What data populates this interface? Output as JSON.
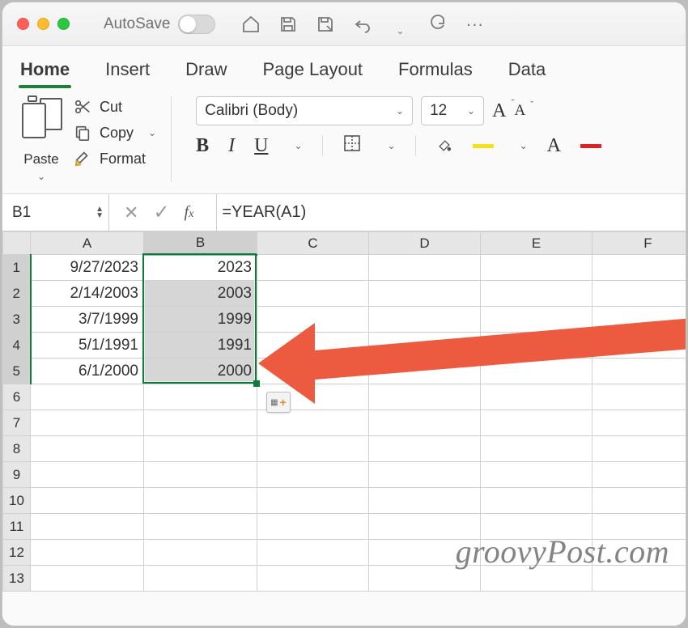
{
  "qat": {
    "autosave_label": "AutoSave",
    "autosave_on": false
  },
  "tabs": [
    "Home",
    "Insert",
    "Draw",
    "Page Layout",
    "Formulas",
    "Data"
  ],
  "active_tab": "Home",
  "ribbon": {
    "paste_label": "Paste",
    "cut_label": "Cut",
    "copy_label": "Copy",
    "format_label": "Format",
    "font_name": "Calibri (Body)",
    "font_size": "12"
  },
  "namebox": "B1",
  "formula": "=YEAR(A1)",
  "columns": [
    "A",
    "B",
    "C",
    "D",
    "E",
    "F"
  ],
  "row_headers": [
    "1",
    "2",
    "3",
    "4",
    "5",
    "6",
    "7",
    "8",
    "9",
    "10",
    "11",
    "12",
    "13"
  ],
  "selection": {
    "col": "B",
    "rows": [
      1,
      5
    ],
    "active": "B1"
  },
  "cells": {
    "A": [
      "9/27/2023",
      "2/14/2003",
      "3/7/1999",
      "5/1/1991",
      "6/1/2000",
      "",
      "",
      "",
      "",
      "",
      "",
      "",
      ""
    ],
    "B": [
      "2023",
      "2003",
      "1999",
      "1991",
      "2000",
      "",
      "",
      "",
      "",
      "",
      "",
      "",
      ""
    ],
    "C": [
      "",
      "",
      "",
      "",
      "",
      "",
      "",
      "",
      "",
      "",
      "",
      "",
      ""
    ],
    "D": [
      "",
      "",
      "",
      "",
      "",
      "",
      "",
      "",
      "",
      "",
      "",
      "",
      ""
    ],
    "E": [
      "",
      "",
      "",
      "",
      "",
      "",
      "",
      "",
      "",
      "",
      "",
      "",
      ""
    ],
    "F": [
      "",
      "",
      "",
      "",
      "",
      "",
      "",
      "",
      "",
      "",
      "",
      "",
      ""
    ]
  },
  "watermark": "groovyPost.com"
}
